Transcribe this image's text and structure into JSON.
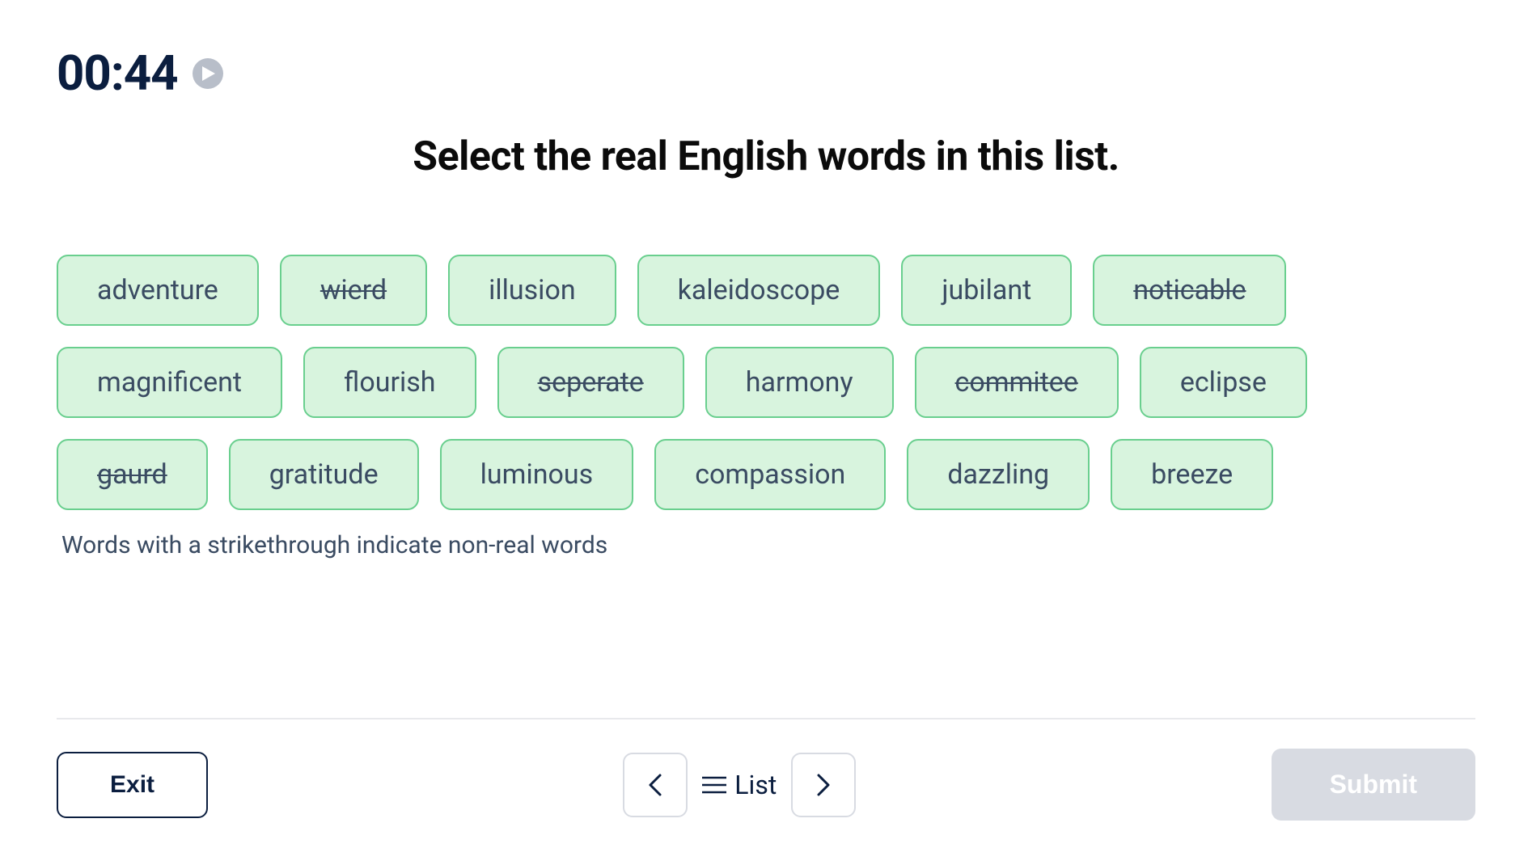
{
  "timer": "00:44",
  "title": "Select the real English words in this list.",
  "words": [
    {
      "label": "adventure",
      "strike": false
    },
    {
      "label": "wierd",
      "strike": true
    },
    {
      "label": "illusion",
      "strike": false
    },
    {
      "label": "kaleidoscope",
      "strike": false
    },
    {
      "label": "jubilant",
      "strike": false
    },
    {
      "label": "noticable",
      "strike": true
    },
    {
      "label": "magnificent",
      "strike": false
    },
    {
      "label": "flourish",
      "strike": false
    },
    {
      "label": "seperate",
      "strike": true
    },
    {
      "label": "harmony",
      "strike": false
    },
    {
      "label": "commitee",
      "strike": true
    },
    {
      "label": "eclipse",
      "strike": false
    },
    {
      "label": "gaurd",
      "strike": true
    },
    {
      "label": "gratitude",
      "strike": false
    },
    {
      "label": "luminous",
      "strike": false
    },
    {
      "label": "compassion",
      "strike": false
    },
    {
      "label": "dazzling",
      "strike": false
    },
    {
      "label": "breeze",
      "strike": false
    }
  ],
  "hint": "Words with a strikethrough indicate non-real words",
  "footer": {
    "exit": "Exit",
    "list": "List",
    "submit": "Submit"
  }
}
